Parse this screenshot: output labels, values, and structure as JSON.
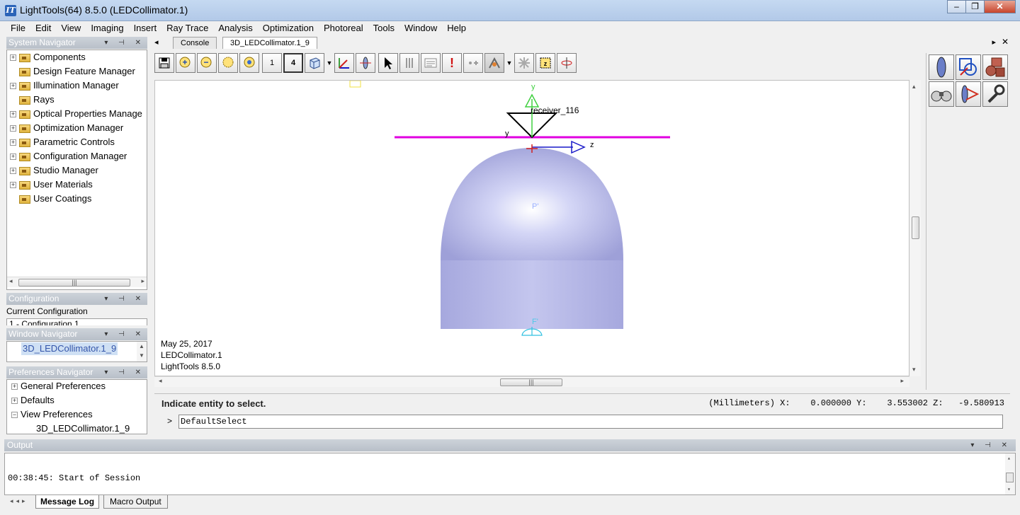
{
  "window": {
    "title": "LightTools(64) 8.5.0  (LEDCollimator.1)",
    "app_icon": "IT",
    "minimize": "–",
    "restore": "❐",
    "close": "✕"
  },
  "menu": [
    "File",
    "Edit",
    "View",
    "Imaging",
    "Insert",
    "Ray Trace",
    "Analysis",
    "Optimization",
    "Photoreal",
    "Tools",
    "Window",
    "Help"
  ],
  "system_navigator": {
    "title": "System Navigator",
    "items": [
      {
        "label": "Components",
        "expandable": true
      },
      {
        "label": "Design Feature Manager",
        "expandable": false
      },
      {
        "label": "Illumination Manager",
        "expandable": true
      },
      {
        "label": "Rays",
        "expandable": false
      },
      {
        "label": "Optical Properties Manage",
        "expandable": true
      },
      {
        "label": "Optimization Manager",
        "expandable": true
      },
      {
        "label": "Parametric Controls",
        "expandable": true
      },
      {
        "label": "Configuration Manager",
        "expandable": true
      },
      {
        "label": "Studio Manager",
        "expandable": true
      },
      {
        "label": "User Materials",
        "expandable": true
      },
      {
        "label": "User Coatings",
        "expandable": false
      }
    ]
  },
  "configuration": {
    "title": "Configuration",
    "current_label": "Current Configuration",
    "current_value": "1 - Configuration 1"
  },
  "window_navigator": {
    "title": "Window Navigator",
    "items": [
      "3D_LEDCollimator.1_9"
    ]
  },
  "preferences_navigator": {
    "title": "Preferences Navigator",
    "items": [
      {
        "label": "General Preferences",
        "exp": "+"
      },
      {
        "label": "Defaults",
        "exp": "+"
      },
      {
        "label": "View Preferences",
        "exp": "−"
      },
      {
        "label": "3D_LEDCollimator.1_9",
        "exp": ""
      }
    ]
  },
  "doc_tabs": {
    "tabs": [
      "Console",
      "3D_LEDCollimator.1_9"
    ],
    "active": "3D_LEDCollimator.1_9"
  },
  "toolbar": [
    "save-icon",
    "zoom-in-icon",
    "zoom-out-icon",
    "zoom-box-icon",
    "zoom-fit-icon",
    "single-view-icon",
    "quad-view-icon",
    "view-cube-icon",
    "axes-icon",
    "lens-view-icon",
    "select-arrow-icon",
    "mirror-icon",
    "notes-icon",
    "alert-icon",
    "add-point-icon",
    "render-icon",
    "star-icon",
    "zoom-region-icon",
    "rotate-icon"
  ],
  "toolbar_labels": {
    "single": "1",
    "quad": "4",
    "alert": "!"
  },
  "viewport": {
    "receiver_label": "receiver_116",
    "axis_y": "y",
    "axis_y2": "y",
    "axis_z": "z",
    "point_label_p": "P'",
    "point_label_f": "F'",
    "stamp_date": "May 25, 2017",
    "stamp_file": "LEDCollimator.1",
    "stamp_version": "LightTools 8.5.0"
  },
  "status": {
    "prompt": "Indicate entity to select.",
    "coords": "(Millimeters) X:    0.000000 Y:    3.553002 Z:   -9.580913",
    "cmd_prefix": ">",
    "command": "DefaultSelect"
  },
  "output": {
    "title": "Output",
    "lines": [
      "00:38:45: Start of Session"
    ],
    "tabs": [
      "Message Log",
      "Macro Output"
    ],
    "active_tab": "Message Log"
  },
  "colors": {
    "magenta_line": "#e000e0",
    "green_axis": "#40d040",
    "blue_axis": "#1818c8",
    "lens": "#b4b6ec"
  }
}
